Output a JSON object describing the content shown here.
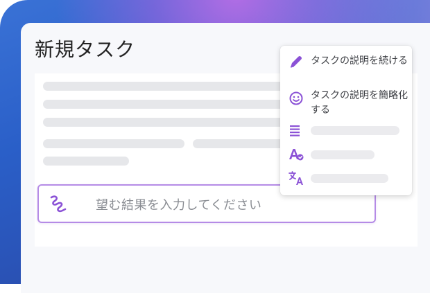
{
  "page": {
    "title": "新規タスク"
  },
  "prompt": {
    "placeholder_text": "望む結果を入力してください",
    "icon": "wand-scribble-icon"
  },
  "menu": {
    "items": [
      {
        "label": "タスクの説明を続ける",
        "icon": "pen-icon"
      },
      {
        "label": "タスクの説明を簡略化する",
        "icon": "smiley-icon"
      },
      {
        "label": "",
        "icon": "text-lines-icon"
      },
      {
        "label": "",
        "icon": "spellcheck-icon"
      },
      {
        "label": "",
        "icon": "translate-icon"
      }
    ]
  },
  "colors": {
    "accent": "#8b52d6",
    "prompt_border": "#b58be6",
    "placeholder_bar": "#e6e7ea"
  }
}
